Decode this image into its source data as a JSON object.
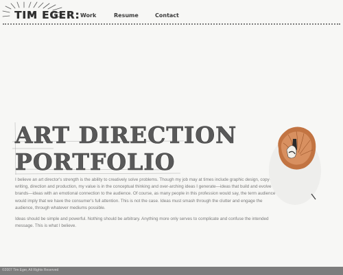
{
  "header": {
    "logo_text": "TIM EGER:",
    "nav": [
      {
        "label": "Work"
      },
      {
        "label": "Resume"
      },
      {
        "label": "Contact"
      }
    ]
  },
  "hero": {
    "line1": "ART DIRECTION",
    "line2": "PORTFOLIO"
  },
  "body": {
    "paragraph1": "I believe an art director's strength is the ability to creatively solve problems. Though my job may at times include graphic design, copy-writing, direction and production, my value is in the conceptual thinking and over-arching ideas I generate—ideas that build and evolve brands—ideas with an emotional connection to the audience. Of course, as many people in this profession would say, the term audience would imply that we have the consumer's full attention. This is not the case. Ideas must smash through the clutter and engage the audience, through whatever mediums possible.",
    "paragraph2": "Ideas should be simple and powerful. Nothing should be arbitrary. Anything more only serves to complicate and confuse the intended message. This is what I believe."
  },
  "footer": {
    "copyright": "©2007 Tim Eger, All Rights Reserved"
  },
  "colors": {
    "background": "#f7f7f5",
    "logo_text": "#2f2f2f",
    "body_text": "#7a7a7a",
    "footer_bg": "#7d7d7d",
    "pencil_shaving": "#c0703a"
  },
  "images": {
    "decoration": "pencil-shavings-image",
    "logo_ornament": "sunburst-icon"
  }
}
